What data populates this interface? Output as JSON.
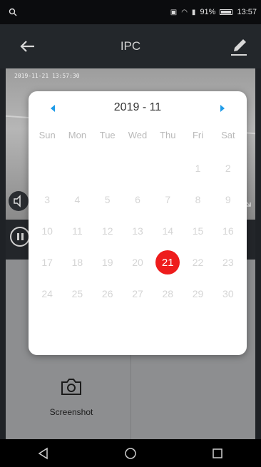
{
  "status_bar": {
    "battery_percent": "91%",
    "time": "13:57"
  },
  "app_bar": {
    "title": "IPC"
  },
  "video": {
    "timestamp": "2019-11-21 13:57:30"
  },
  "panel": {
    "screenshot_label": "Screenshot"
  },
  "calendar": {
    "month_label": "2019 - 11",
    "weekdays": [
      "Sun",
      "Mon",
      "Tue",
      "Wed",
      "Thu",
      "Fri",
      "Sat"
    ],
    "weeks": [
      [
        "",
        "",
        "",
        "",
        "",
        "1",
        "2"
      ],
      [
        "3",
        "4",
        "5",
        "6",
        "7",
        "8",
        "9"
      ],
      [
        "10",
        "11",
        "12",
        "13",
        "14",
        "15",
        "16"
      ],
      [
        "17",
        "18",
        "19",
        "20",
        "21",
        "22",
        "23"
      ],
      [
        "24",
        "25",
        "26",
        "27",
        "28",
        "29",
        "30"
      ]
    ],
    "selected_day": "21",
    "selected_color": "#ee1c1c",
    "nav_color": "#1e9be8"
  },
  "icons": {
    "back": "arrow-left-icon",
    "edit": "pencil-icon",
    "prev_month": "triangle-left-icon",
    "next_month": "triangle-right-icon",
    "screenshot": "camera-icon",
    "nav_back": "triangle-back-icon",
    "nav_home": "circle-home-icon",
    "nav_recents": "square-recents-icon"
  }
}
